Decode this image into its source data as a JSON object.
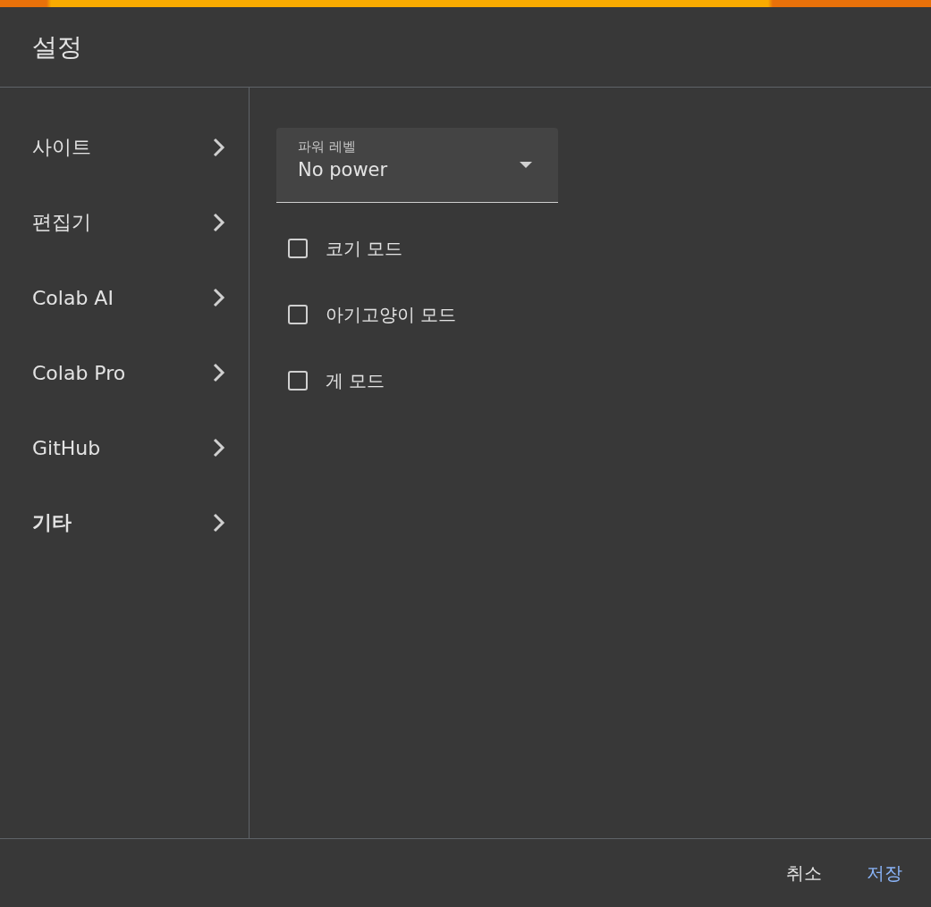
{
  "dialog": {
    "title": "설정"
  },
  "sidebar": {
    "items": [
      {
        "label": "사이트",
        "selected": false
      },
      {
        "label": "편집기",
        "selected": false
      },
      {
        "label": "Colab AI",
        "selected": false
      },
      {
        "label": "Colab Pro",
        "selected": false
      },
      {
        "label": "GitHub",
        "selected": false
      },
      {
        "label": "기타",
        "selected": true
      }
    ]
  },
  "power_level": {
    "label": "파워 레벨",
    "value": "No power"
  },
  "options": [
    {
      "label": "코기 모드",
      "checked": false
    },
    {
      "label": "아기고양이 모드",
      "checked": false
    },
    {
      "label": "게 모드",
      "checked": false
    }
  ],
  "buttons": [
    {
      "label": "취소",
      "kind": "secondary"
    },
    {
      "label": "저장",
      "kind": "primary"
    }
  ]
}
